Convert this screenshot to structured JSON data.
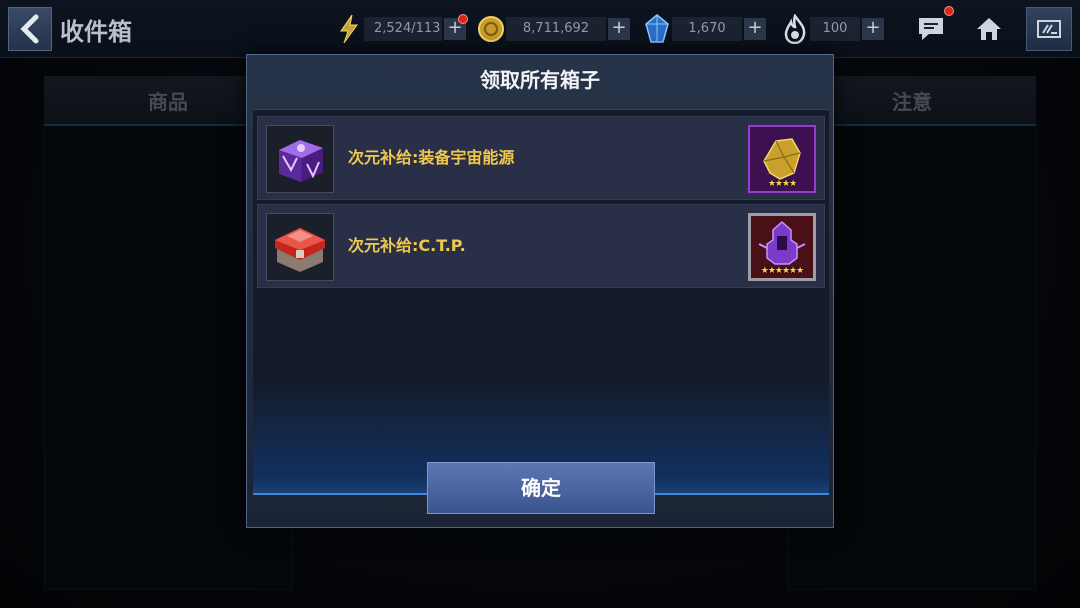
{
  "header": {
    "title": "收件箱",
    "resources": [
      {
        "name": "energy",
        "value": "2,524/113",
        "icon": "lightning-icon"
      },
      {
        "name": "gold",
        "value": "8,711,692",
        "icon": "gold-coin-icon"
      },
      {
        "name": "crystal",
        "value": "1,670",
        "icon": "crystal-icon"
      },
      {
        "name": "stamina",
        "value": "100",
        "icon": "flame-icon"
      }
    ],
    "plus_label": "+"
  },
  "background_tabs": {
    "left": "商品",
    "right": "注意"
  },
  "dialog": {
    "title": "领取所有箱子",
    "items": [
      {
        "name": "次元补给:装备宇宙能源",
        "reward_stars": "★★★★",
        "reward_color": "#9a3bd0"
      },
      {
        "name": "次元补给:C.T.P.",
        "reward_stars": "★★★★★★",
        "reward_color": "#9f9ca6"
      }
    ],
    "confirm_label": "确定"
  },
  "colors": {
    "accent_blue": "#3f86e0",
    "item_text": "#f0c84a",
    "notification": "#d8261e"
  }
}
